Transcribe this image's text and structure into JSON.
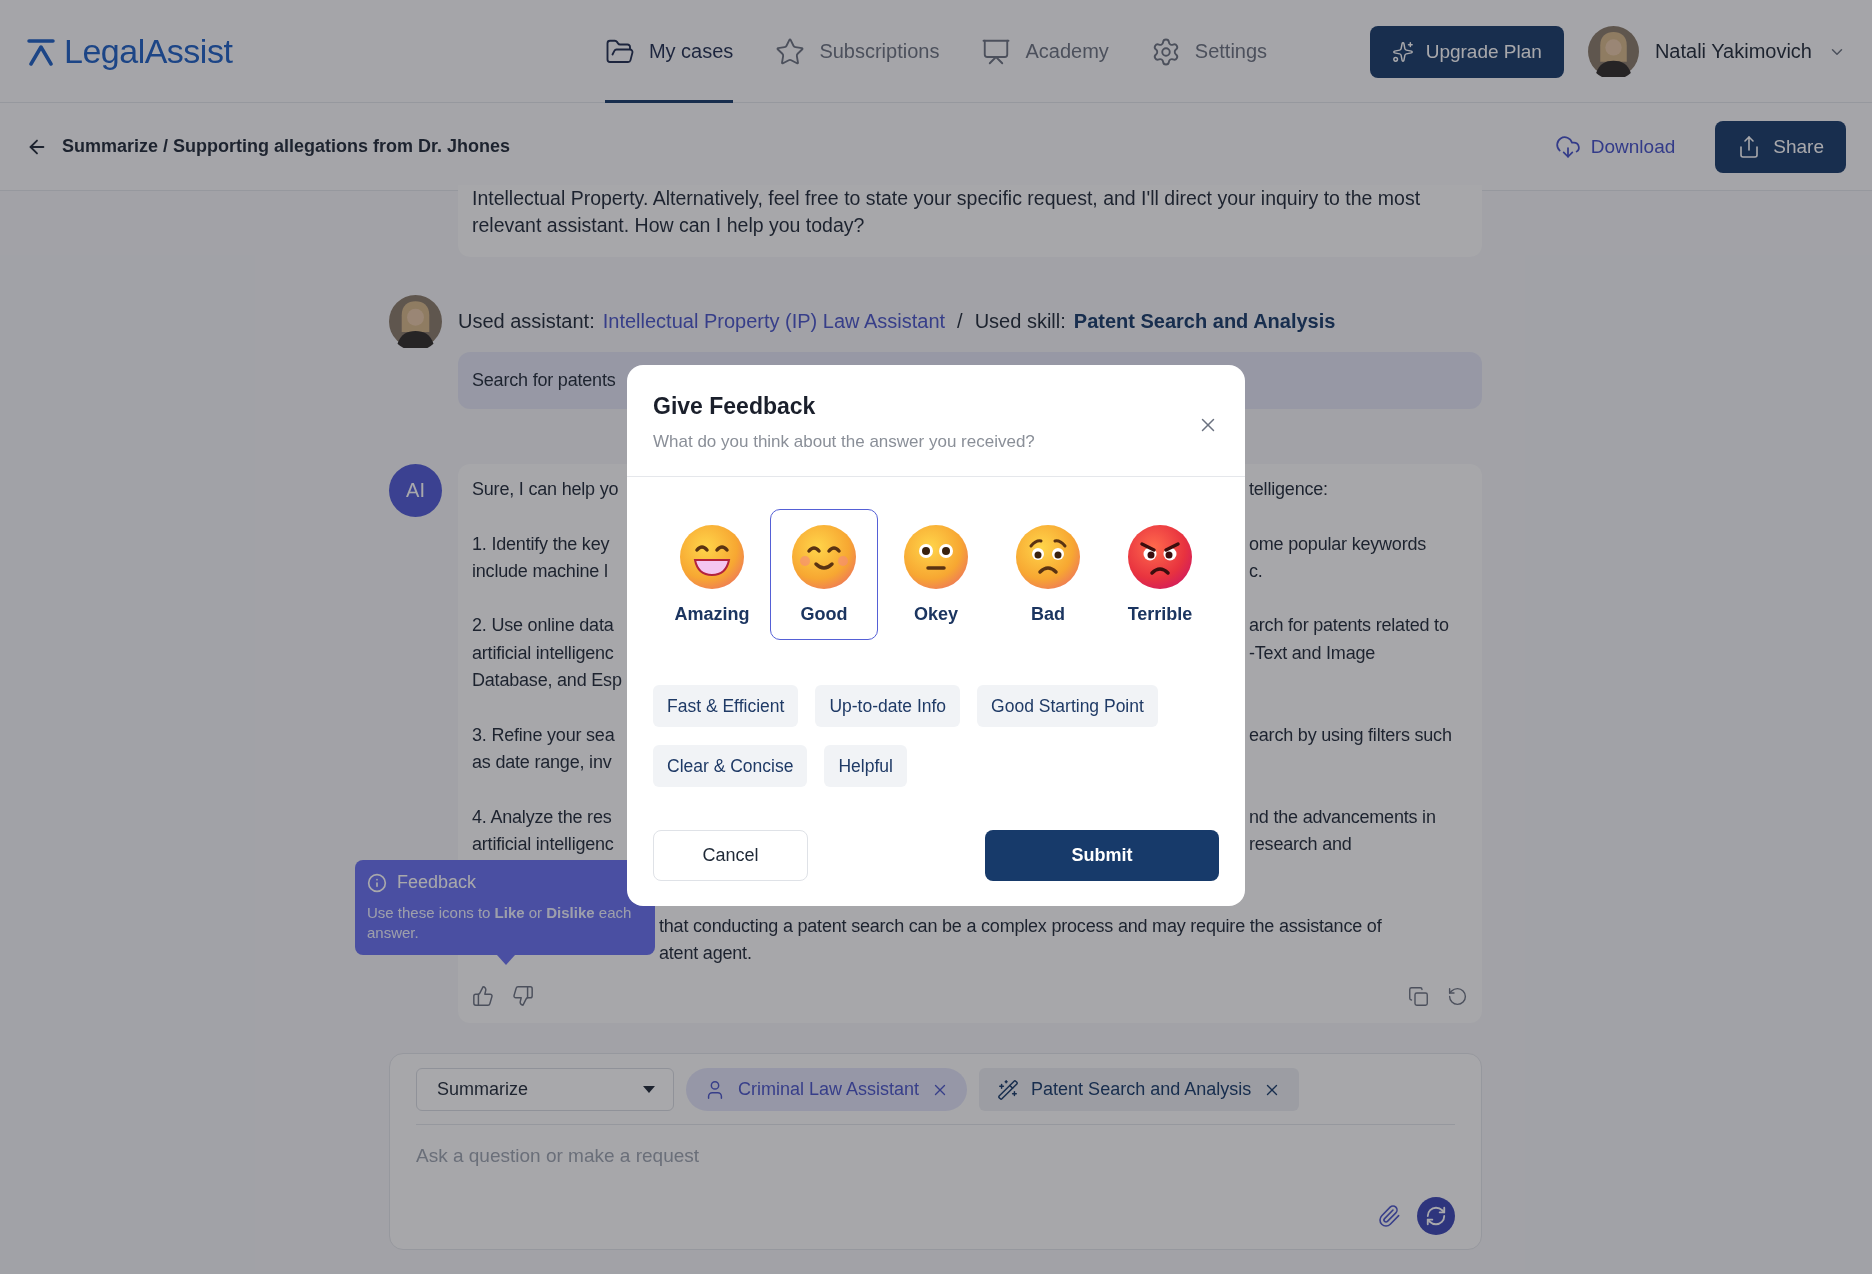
{
  "brand": {
    "name": "LegalAssist"
  },
  "nav": [
    {
      "label": "My cases",
      "selected": true
    },
    {
      "label": "Subscriptions",
      "selected": false
    },
    {
      "label": "Academy",
      "selected": false
    },
    {
      "label": "Settings",
      "selected": false
    }
  ],
  "upgrade_button": "Upgrade Plan",
  "user": {
    "name": "Natali Yakimovich"
  },
  "breadcrumb": "Summarize / Supporting allegations from Dr. Jhones",
  "actions": {
    "download": "Download",
    "share": "Share"
  },
  "intro_message": "Intellectual Property. Alternatively, feel free to state your specific request, and I'll direct your inquiry to the most relevant assistant. How can I help you today?",
  "used": {
    "assistant_label": "Used assistant:",
    "assistant": "Intellectual Property (IP) Law Assistant",
    "separator": "/",
    "skill_label": "Used skill:",
    "skill": "Patent Search and Analysis"
  },
  "user_message": "Search for patents",
  "ai": {
    "avatar": "AI",
    "paragraphs": [
      {
        "kind": "split",
        "lines": [
          {
            "left": "Sure, I can help yo",
            "right": "telligence:"
          }
        ]
      },
      {
        "kind": "split",
        "lines": [
          {
            "left": "1. Identify the key",
            "right": "ome popular keywords"
          },
          {
            "left": "include machine l",
            "right": "c."
          }
        ]
      },
      {
        "kind": "split",
        "lines": [
          {
            "left": "2. Use online data",
            "right": "arch for patents related to"
          },
          {
            "left": "artificial intelligenc",
            "right": "-Text and Image"
          },
          {
            "left": "Database, and Esp"
          }
        ]
      },
      {
        "kind": "split",
        "lines": [
          {
            "left": "3. Refine your sea",
            "right": "earch by using filters such"
          },
          {
            "left": "as date range, inv"
          }
        ]
      },
      {
        "kind": "split",
        "lines": [
          {
            "left": "4. Analyze the res",
            "right": "nd the advancements in"
          },
          {
            "left": "artificial intelligenc",
            "right": "research and"
          }
        ]
      },
      {
        "kind": "after_tooltip",
        "lines": [
          {
            "left": "that conducting a patent search can be a complex process and may require the assistance of"
          },
          {
            "left": "atent agent."
          }
        ]
      }
    ]
  },
  "tooltip": {
    "title": "Feedback",
    "body": "Use these icons to **Like** or **Dislike** each answer."
  },
  "composer": {
    "mode": "Summarize",
    "chips": [
      {
        "kind": "assistant",
        "label": "Criminal Law Assistant"
      },
      {
        "kind": "skill",
        "label": "Patent Search and Analysis"
      }
    ],
    "placeholder": "Ask a question or make a request"
  },
  "modal": {
    "title": "Give Feedback",
    "subtitle": "What do you think about the answer you received?",
    "reactions": [
      {
        "kind": "grin",
        "label": "Amazing",
        "selected": false
      },
      {
        "kind": "smile",
        "label": "Good",
        "selected": true
      },
      {
        "kind": "neutral",
        "label": "Okey",
        "selected": false
      },
      {
        "kind": "worried",
        "label": "Bad",
        "selected": false
      },
      {
        "kind": "angry",
        "label": "Terrible",
        "selected": false
      }
    ],
    "tags": [
      "Fast & Efficient",
      "Up-to-date Info",
      "Good Starting Point",
      "Clear & Concise",
      "Helpful"
    ],
    "cancel": "Cancel",
    "submit": "Submit"
  }
}
